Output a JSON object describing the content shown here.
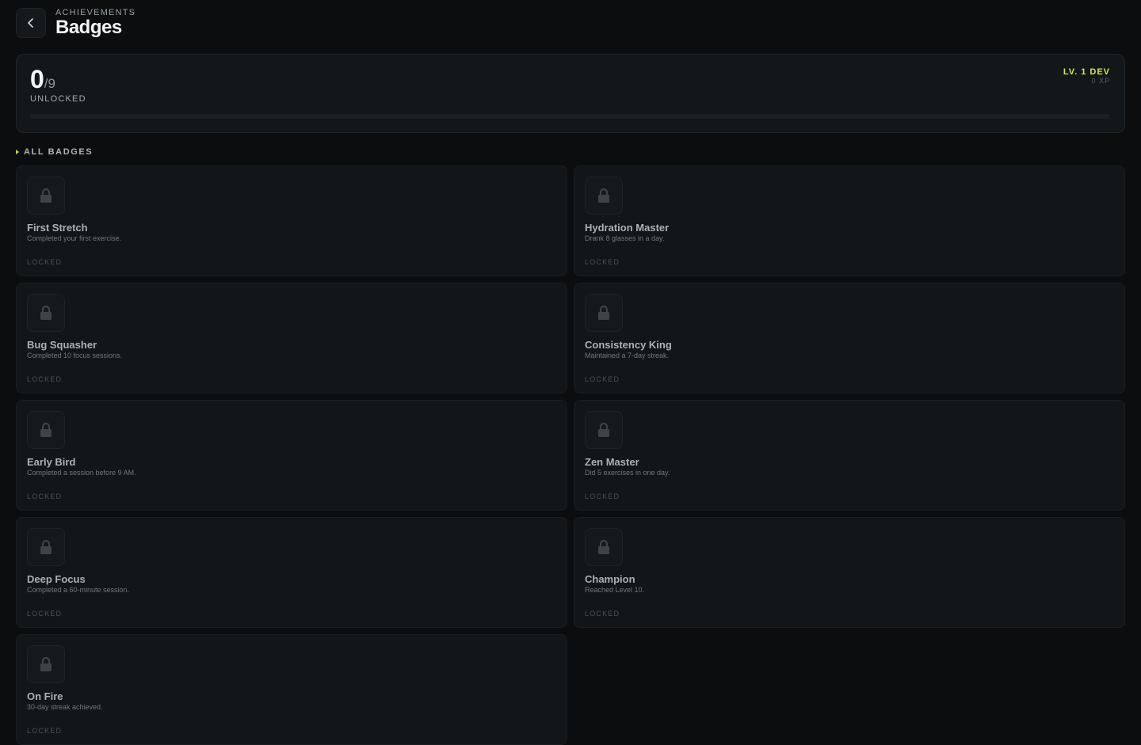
{
  "header": {
    "eyebrow": "ACHIEVEMENTS",
    "title": "Badges"
  },
  "summary": {
    "unlocked_count": "0",
    "total": "/9",
    "unlocked_label": "UNLOCKED",
    "level_title": "LV. 1 DEV",
    "xp": "0 XP",
    "progress_fraction": 0
  },
  "section": {
    "label": "ALL BADGES"
  },
  "colors": {
    "accent": "#d4e84a",
    "background": "#0b0d0e",
    "card": "#121618"
  },
  "badges": [
    {
      "name": "First Stretch",
      "description": "Completed your first exercise.",
      "status": "LOCKED",
      "icon": "lock-icon"
    },
    {
      "name": "Hydration Master",
      "description": "Drank 8 glasses in a day.",
      "status": "LOCKED",
      "icon": "lock-icon"
    },
    {
      "name": "Bug Squasher",
      "description": "Completed 10 focus sessions.",
      "status": "LOCKED",
      "icon": "lock-icon"
    },
    {
      "name": "Consistency King",
      "description": "Maintained a 7-day streak.",
      "status": "LOCKED",
      "icon": "lock-icon"
    },
    {
      "name": "Early Bird",
      "description": "Completed a session before 9 AM.",
      "status": "LOCKED",
      "icon": "lock-icon"
    },
    {
      "name": "Zen Master",
      "description": "Did 5 exercises in one day.",
      "status": "LOCKED",
      "icon": "lock-icon"
    },
    {
      "name": "Deep Focus",
      "description": "Completed a 60-minute session.",
      "status": "LOCKED",
      "icon": "lock-icon"
    },
    {
      "name": "Champion",
      "description": "Reached Level 10.",
      "status": "LOCKED",
      "icon": "lock-icon"
    },
    {
      "name": "On Fire",
      "description": "30-day streak achieved.",
      "status": "LOCKED",
      "icon": "lock-icon"
    }
  ]
}
